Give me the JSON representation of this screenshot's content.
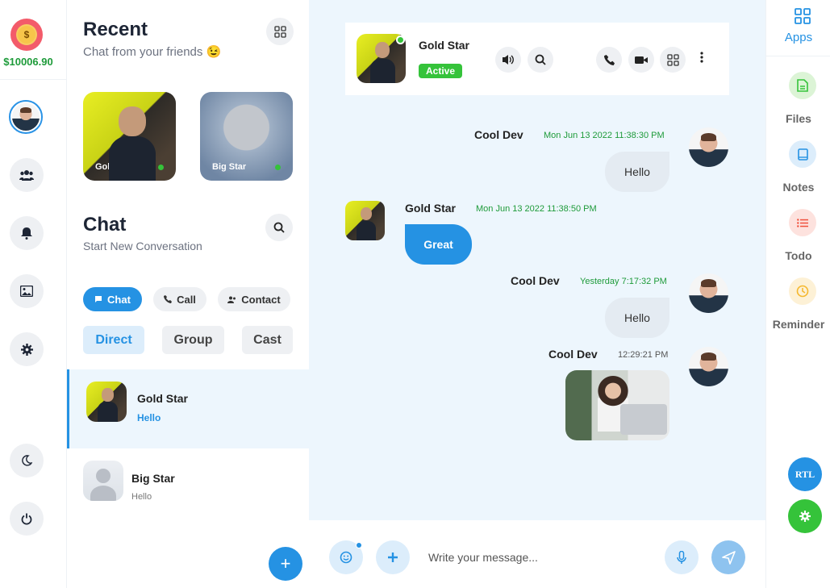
{
  "rail": {
    "balance": "$10006.90",
    "items": [
      "users-icon",
      "bell-icon",
      "image-icon",
      "gear-icon"
    ],
    "bottom": [
      "moon-icon",
      "power-icon"
    ]
  },
  "recent": {
    "title": "Recent",
    "subtitle": "Chat from your friends 😉",
    "cards": [
      {
        "name": "Gold Star",
        "online": true
      },
      {
        "name": "Big Star",
        "online": true
      }
    ]
  },
  "chat_panel": {
    "title": "Chat",
    "subtitle": "Start New Conversation",
    "pills": [
      {
        "label": "Chat",
        "icon": "message-icon",
        "active": true
      },
      {
        "label": "Call",
        "icon": "phone-icon",
        "active": false
      },
      {
        "label": "Contact",
        "icon": "contacts-icon",
        "active": false
      }
    ],
    "segments": [
      {
        "label": "Direct",
        "active": true
      },
      {
        "label": "Group",
        "active": false
      },
      {
        "label": "Cast",
        "active": false
      }
    ],
    "conversations": [
      {
        "name": "Gold Star",
        "message": "Hello",
        "active": true
      },
      {
        "name": "Big Star",
        "message": "Hello",
        "active": false
      }
    ]
  },
  "header": {
    "name": "Gold Star",
    "status": "Active"
  },
  "messages": [
    {
      "sender": "Cool Dev",
      "time": "Mon Jun 13 2022 11:38:30 PM",
      "text": "Hello",
      "side": "right"
    },
    {
      "sender": "Gold Star",
      "time": "Mon Jun 13 2022 11:38:50 PM",
      "text": "Great",
      "side": "left"
    },
    {
      "sender": "Cool Dev",
      "time": "Yesterday 7:17:32 PM",
      "text": "Hello",
      "side": "right"
    },
    {
      "sender": "Cool Dev",
      "time": "12:29:21 PM",
      "text": "",
      "side": "right",
      "attachment": "photo"
    }
  ],
  "composer": {
    "placeholder": "Write your message..."
  },
  "apps": {
    "title": "Apps",
    "items": [
      {
        "label": "Files",
        "icon": "file-icon",
        "color": "#35c33a"
      },
      {
        "label": "Notes",
        "icon": "book-icon",
        "color": "#2592e3"
      },
      {
        "label": "Todo",
        "icon": "list-icon",
        "color": "#f0503c"
      },
      {
        "label": "Reminder",
        "icon": "clock-icon",
        "color": "#f5b82e"
      }
    ],
    "rtl_label": "RTL"
  },
  "colors": {
    "accent": "#2592e3",
    "online": "#35c33a",
    "chat_bg": "#edf6fd"
  }
}
